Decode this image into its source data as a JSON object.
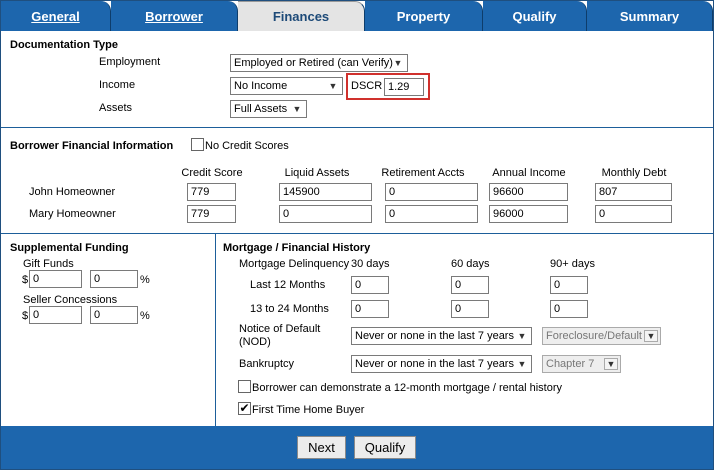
{
  "tabs": [
    {
      "label": "General"
    },
    {
      "label": "Borrower"
    },
    {
      "label": "Finances"
    },
    {
      "label": "Property"
    },
    {
      "label": "Qualify"
    },
    {
      "label": "Summary"
    }
  ],
  "documentation": {
    "title": "Documentation Type",
    "employment_label": "Employment",
    "employment_value": "Employed or Retired (can Verify)",
    "income_label": "Income",
    "income_value": "No Income",
    "dscr_label": "DSCR",
    "dscr_value": "1.29",
    "assets_label": "Assets",
    "assets_value": "Full Assets"
  },
  "borrower_financial": {
    "title": "Borrower Financial Information",
    "no_credit_label": "No Credit Scores",
    "columns": [
      "Credit Score",
      "Liquid Assets",
      "Retirement Accts",
      "Annual Income",
      "Monthly Debt"
    ],
    "rows": [
      {
        "name": "John Homeowner",
        "values": [
          "779",
          "145900",
          "0",
          "96600",
          "807"
        ]
      },
      {
        "name": "Mary Homeowner",
        "values": [
          "779",
          "0",
          "0",
          "96000",
          "0"
        ]
      }
    ]
  },
  "supplemental": {
    "title": "Supplemental Funding",
    "gift_label": "Gift Funds",
    "gift_amount": "0",
    "gift_percent": "0",
    "seller_label": "Seller Concessions",
    "seller_amount": "0",
    "seller_percent": "0",
    "dollar": "$",
    "percent_sign": "%"
  },
  "history": {
    "title": "Mortgage / Financial History",
    "delinquency_label": "Mortgage Delinquency",
    "col_30": "30 days",
    "col_60": "60 days",
    "col_90": "90+ days",
    "row1_label": "Last 12 Months",
    "row1": [
      "0",
      "0",
      "0"
    ],
    "row2_label": "13 to 24 Months",
    "row2": [
      "0",
      "0",
      "0"
    ],
    "nod_label_1": "Notice of Default",
    "nod_label_2": "(NOD)",
    "nod_value": "Never or none in the last 7 years",
    "nod_type": "Foreclosure/Default",
    "bankruptcy_label": "Bankruptcy",
    "bankruptcy_value": "Never or none in the last 7 years",
    "bankruptcy_type": "Chapter 7",
    "rental_history_label": "Borrower can demonstrate a 12-month mortgage / rental history",
    "first_time_label": "First Time Home Buyer",
    "first_time_checked": "✔"
  },
  "buttons": {
    "next": "Next",
    "qualify": "Qualify"
  }
}
